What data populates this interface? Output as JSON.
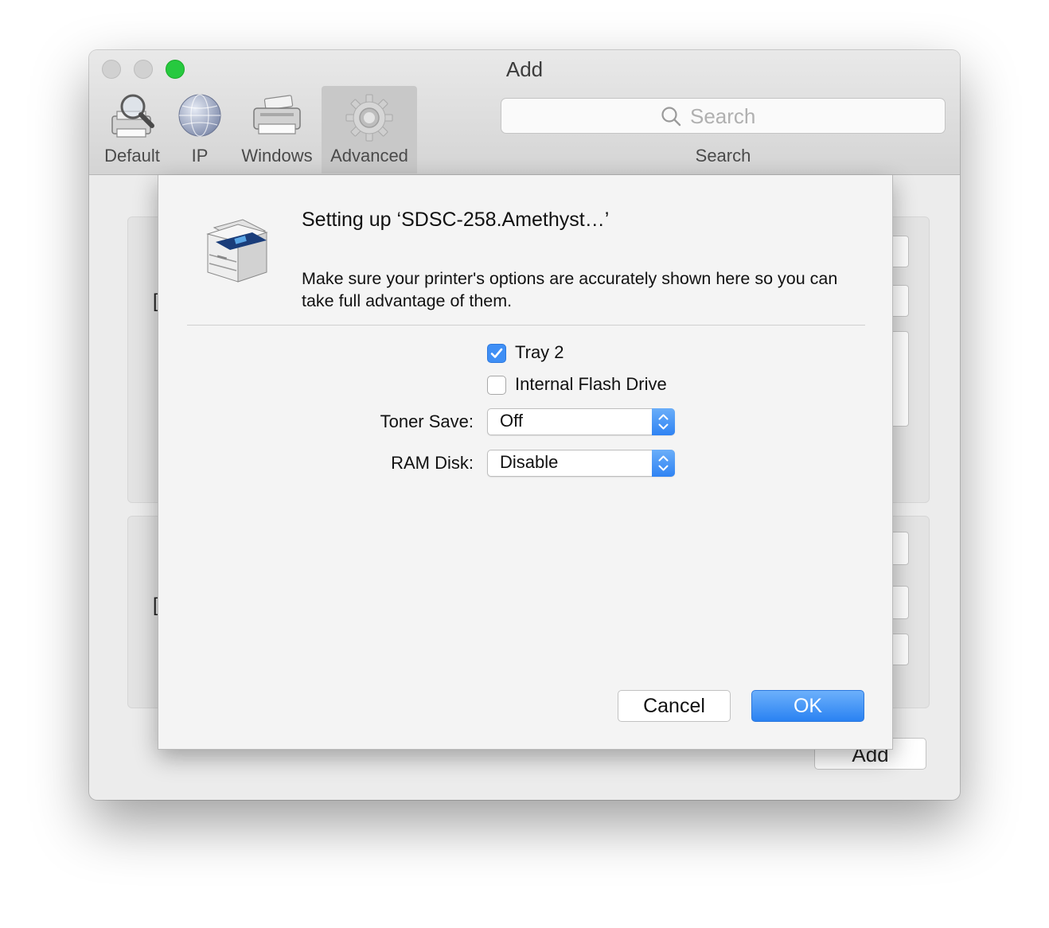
{
  "window": {
    "title": "Add"
  },
  "toolbar": {
    "items": [
      {
        "label": "Default",
        "icon": "printer-magnifier-icon",
        "selected": false
      },
      {
        "label": "IP",
        "icon": "globe-icon",
        "selected": false
      },
      {
        "label": "Windows",
        "icon": "windows-printer-icon",
        "selected": false
      },
      {
        "label": "Advanced",
        "icon": "gear-icon",
        "selected": true
      }
    ],
    "search": {
      "placeholder": "Search",
      "label": "Search"
    }
  },
  "background": {
    "add_label": "Add"
  },
  "sheet": {
    "title": "Setting up ‘SDSC-258.Amethyst…’",
    "message": "Make sure your printer's options are accurately shown here so you can take full advantage of them.",
    "options": {
      "tray2": {
        "label": "Tray 2",
        "checked": true
      },
      "flash": {
        "label": "Internal Flash Drive",
        "checked": false
      }
    },
    "toner_save": {
      "label": "Toner Save:",
      "value": "Off"
    },
    "ram_disk": {
      "label": "RAM Disk:",
      "value": "Disable"
    },
    "cancel_label": "Cancel",
    "ok_label": "OK"
  },
  "colors": {
    "accent": "#3f8ff5",
    "zoom_green": "#27c93f"
  }
}
